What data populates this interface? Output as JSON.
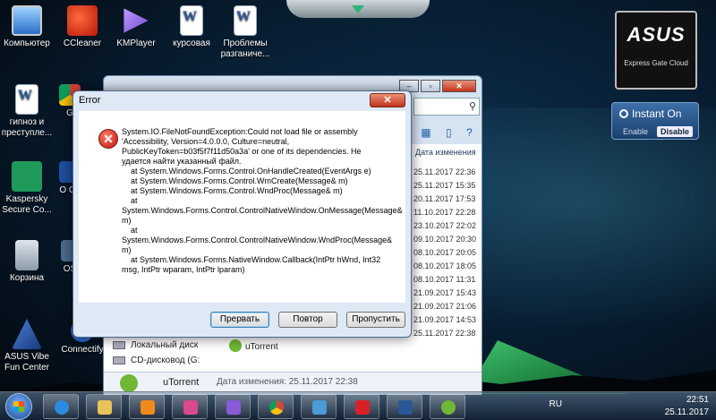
{
  "desktop": {
    "icons": [
      {
        "label": "Компьютер"
      },
      {
        "label": "CCleaner"
      },
      {
        "label": "KMPlayer"
      },
      {
        "label": "курсовая"
      },
      {
        "label": "Проблемы разганиче..."
      },
      {
        "label": "гипноз и преступле..."
      },
      {
        "label": "Kaspersky Secure Co..."
      },
      {
        "label": "Корзина"
      },
      {
        "label": "ASUS Vibe Fun Center"
      },
      {
        "label": "Connectify"
      },
      {
        "label": "G"
      },
      {
        "label": "O Ch"
      },
      {
        "label": "OS"
      }
    ]
  },
  "asus_gadget": {
    "logo": "ASUS",
    "subtitle": "Express Gate Cloud"
  },
  "instant_on": {
    "title": "Instant On",
    "enable": "Enable",
    "disable": "Disable"
  },
  "explorer": {
    "column_header": "Дата изменения",
    "dates": [
      "25.11.2017 22:36",
      "25.11.2017 15:35",
      "20.11.2017 17:53",
      "11.10.2017 22:28",
      "23.10.2017 22:02",
      "09.10.2017 20:30",
      "08.10.2017 20:05",
      "08.10.2017 18:05",
      "08.10.2017 11:31",
      "21.09.2017 15:43",
      "21.09.2017 21:06",
      "21.09.2017 14:53",
      "25.11.2017 22:38"
    ],
    "nav": [
      "Локальный диск",
      "CD-дисковод (G:"
    ],
    "selected_item": "uTorrent",
    "status": {
      "name": "uTorrent",
      "date_label": "Дата изменения: 25.11.2017 22:38"
    }
  },
  "dialog": {
    "title": "Error",
    "message": "System.IO.FileNotFoundException:Could not load file or assembly 'Accessibility, Version=4.0.0.0, Culture=neutral, PublicKeyToken=b03f5f7f11d50a3a' or one of its dependencies. Не удается найти указанный файл.\n    at System.Windows.Forms.Control.OnHandleCreated(EventArgs e)\n    at System.Windows.Forms.Control.WmCreate(Message& m)\n    at System.Windows.Forms.Control.WndProc(Message& m)\n    at\nSystem.Windows.Forms.Control.ControlNativeWindow.OnMessage(Message& m)\n    at\nSystem.Windows.Forms.Control.ControlNativeWindow.WndProc(Message& m)\n    at System.Windows.Forms.NativeWindow.Callback(IntPtr hWnd, Int32 msg, IntPtr wparam, IntPtr lparam)",
    "buttons": {
      "abort": "Прервать",
      "retry": "Повтор",
      "ignore": "Пропустить"
    }
  },
  "taskbar": {
    "language": "RU",
    "time": "22:51",
    "date": "25.11.2017"
  },
  "colors": {
    "desktop_bg": "#071a2c",
    "dialog_bg": "#dfe9f5",
    "close_button": "#c2331b",
    "error_icon": "#c1130b"
  }
}
